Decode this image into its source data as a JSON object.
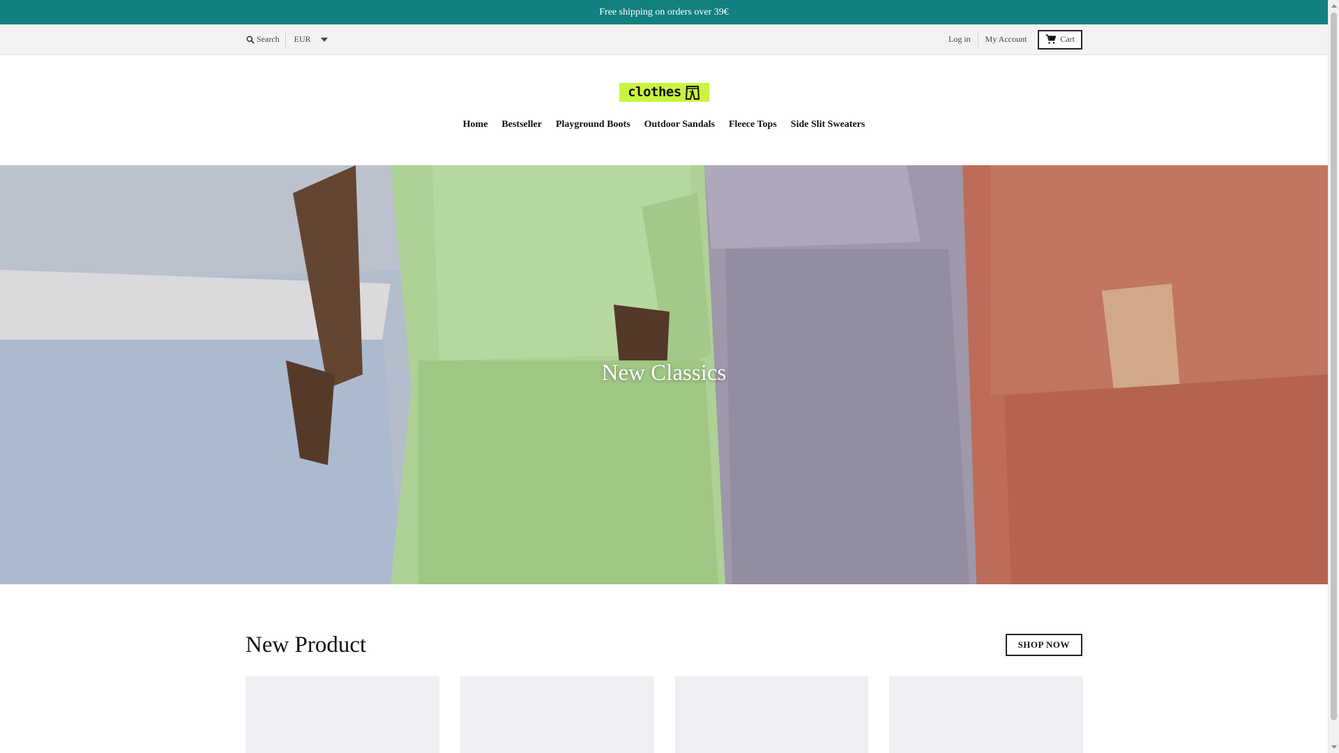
{
  "announcement": {
    "text": "Free shipping on orders over 39€"
  },
  "utility": {
    "search_label": "Search",
    "currency": "EUR",
    "login_label": "Log in",
    "account_label": "My Account",
    "cart_label": "Cart"
  },
  "header": {
    "logo_text": "clothes",
    "nav": [
      {
        "label": "Home"
      },
      {
        "label": "Bestseller"
      },
      {
        "label": "Playground Boots"
      },
      {
        "label": "Outdoor Sandals"
      },
      {
        "label": "Fleece Tops"
      },
      {
        "label": "Side Slit Sweaters"
      }
    ]
  },
  "hero": {
    "title": "New Classics"
  },
  "products": {
    "section_title": "New Product",
    "shop_now_label": "SHOP NOW"
  },
  "icons": {
    "search": "search-icon",
    "currency_caret": "caret-down-icon",
    "cart": "cart-icon",
    "logo_mark": "pants-icon"
  },
  "colors": {
    "announcement_bg": "#138080",
    "logo_bg": "#c8f53c",
    "utility_bg": "#f3f3f3"
  }
}
